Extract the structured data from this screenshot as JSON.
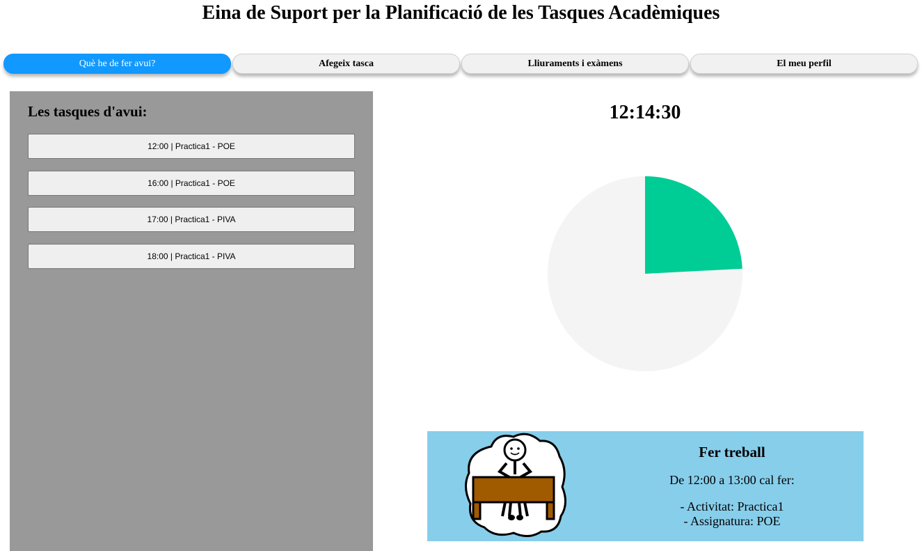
{
  "app": {
    "title": "Eina de Suport per la Planificació de les Tasques Acadèmiques"
  },
  "tabs": [
    {
      "label": "Què he de fer avui?",
      "active": true
    },
    {
      "label": "Afegeix tasca",
      "active": false
    },
    {
      "label": "Lliuraments i exàmens",
      "active": false
    },
    {
      "label": "El meu perfil",
      "active": false
    }
  ],
  "sidebar": {
    "title": "Les tasques d'avui:",
    "tasks": [
      {
        "label": "12:00 | Practica1 - POE"
      },
      {
        "label": "16:00 | Practica1 - POE"
      },
      {
        "label": "17:00 | Practica1 - PIVA"
      },
      {
        "label": "18:00 | Practica1 - PIVA"
      }
    ]
  },
  "clock": {
    "time": "12:14:30"
  },
  "progress": {
    "elapsed_fraction": 0.2417,
    "elapsed_color": "#00cc96",
    "remaining_color": "#f4f4f4"
  },
  "current_task": {
    "icon": "person-working-at-desk-icon",
    "title": "Fer treball",
    "schedule": "De 12:00 a 13:00 cal fer:",
    "activity": "- Activitat: Practica1",
    "subject": "- Assignatura: POE"
  },
  "colors": {
    "active_tab": "#1199ff",
    "sidebar_bg": "#999999",
    "card_bg": "#87ceeb",
    "desk": "#a05a00"
  }
}
